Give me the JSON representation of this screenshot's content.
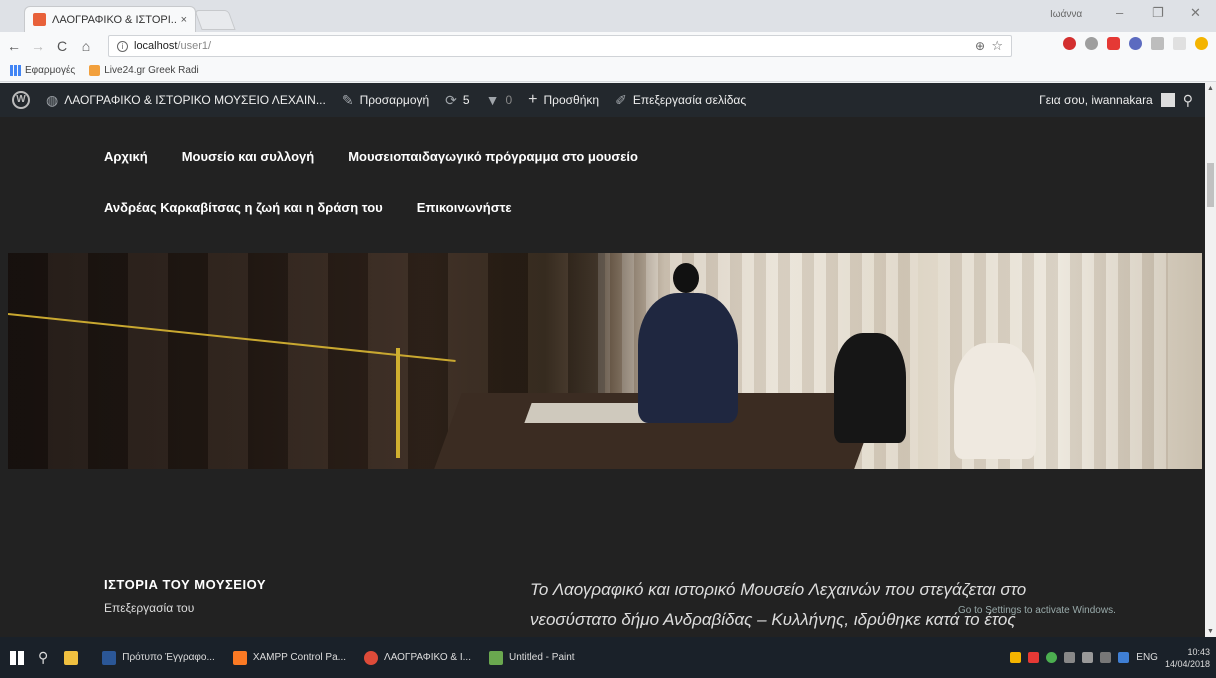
{
  "browser": {
    "tab_title": "ΛΑΟΓΡΑΦΙΚΟ & ΙΣΤΟΡΙ...",
    "tab_close": "×",
    "window_user": "Ιωάννα",
    "window_minimize": "–",
    "window_restore": "❐",
    "window_close": "✕",
    "back": "←",
    "forward": "→",
    "reload": "C",
    "home": "⌂",
    "info": "i",
    "url_host": "localhost",
    "url_path": "/user1/",
    "zoom_icon": "⊕",
    "star_icon": "☆"
  },
  "bookmarks": [
    {
      "label": "Εφαρμογές",
      "icon": "apps-icon"
    },
    {
      "label": "Live24.gr Greek Radi",
      "icon": "rss-icon"
    }
  ],
  "adminbar": {
    "site_name": "ΛΑΟΓΡΑΦΙΚΟ & ΙΣΤΟΡΙΚΟ ΜΟΥΣΕΙΟ ΛΕΧΑΙΝ...",
    "customize": "Προσαρμογή",
    "updates_count": "5",
    "comments_count": "0",
    "new": "Προσθήκη",
    "edit_page": "Επεξεργασία σελίδας",
    "greeting": "Γεια σου, iwannakara"
  },
  "menu": {
    "row1": [
      "Αρχική",
      "Μουσείο και συλλογή",
      "Μουσειοπαιδαγωγικό πρόγραμμα στο μουσείο"
    ],
    "row2": [
      "Ανδρέας Καρκαβίτσας η ζωή και η δράση του",
      "Επικοινωνήστε"
    ]
  },
  "content": {
    "history_title": "ΙΣΤΟΡΙΑ ΤΟΥ ΜΟΥΣΕΙΟΥ",
    "history_sub": "Επεξεργασία του",
    "intro_line1": "Το Λαογραφικό και ιστορικό Μουσείο Λεχαινών που στεγάζεται στο",
    "intro_line2": "νεοσύστατο δήμο Ανδραβίδας – Κυλλήνης, ιδρύθηκε κατά το έτος",
    "activate_windows": "Go to Settings to activate Windows."
  },
  "taskbar": {
    "apps": [
      {
        "label": "Πρότυπο Έγγραφο...",
        "color": "#2b5797"
      },
      {
        "label": "XAMPP Control Pa...",
        "color": "#fb7a24"
      },
      {
        "label": "ΛΑΟΓΡΑΦΙΚΟ & Ι...",
        "color": "#dd4b39"
      },
      {
        "label": "Untitled - Paint",
        "color": "#6aa84f"
      }
    ],
    "lang": "ENG",
    "time": "10:43",
    "date": "14/04/2018"
  },
  "colors": {
    "adminbar_bg": "#23282d",
    "page_bg": "#222222",
    "taskbar_bg": "#1a2129"
  }
}
